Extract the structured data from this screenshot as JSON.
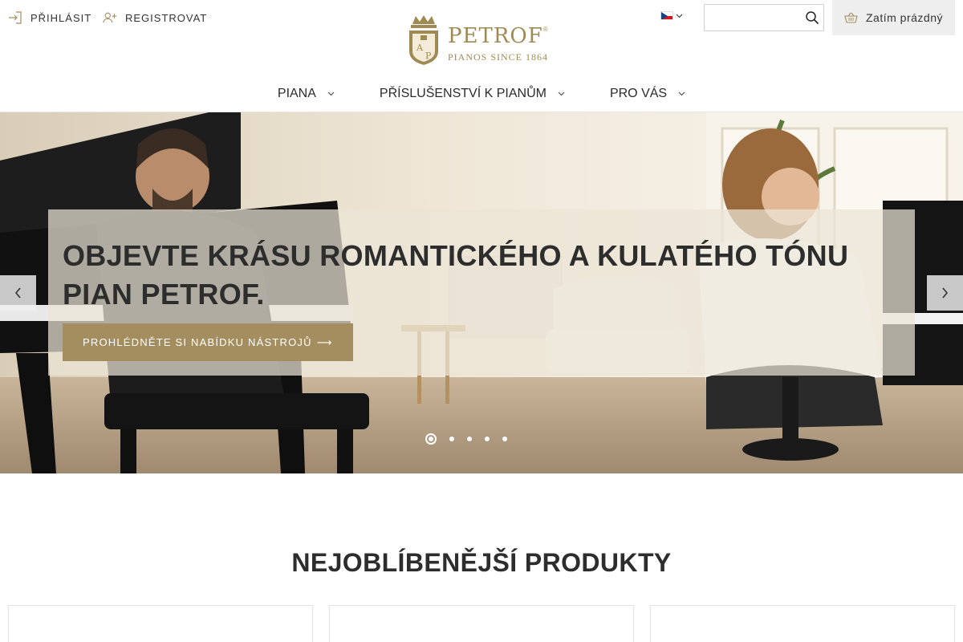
{
  "header": {
    "login_label": "PŘIHLÁSIT",
    "register_label": "REGISTROVAT",
    "logo": {
      "name": "PETROF",
      "registered": "®",
      "tagline": "PIANOS SINCE 1864",
      "crest_letters": [
        "A",
        "P"
      ]
    },
    "language": {
      "flag": "czech-flag-icon"
    },
    "search": {
      "value": "",
      "placeholder": ""
    },
    "cart_label": "Zatím prázdný"
  },
  "nav": {
    "items": [
      {
        "label": "PIANA"
      },
      {
        "label": "PŘÍSLUŠENSTVÍ K PIANŮM"
      },
      {
        "label": "PRO VÁS"
      }
    ]
  },
  "hero": {
    "title": "OBJEVTE KRÁSU ROMANTICKÉHO A KULATÉHO TÓNU PIAN PETROF.",
    "cta_label": "PROHLÉDNĚTE SI NABÍDKU NÁSTROJŮ",
    "cta_arrow": "⟶",
    "slides_count": 5,
    "active_slide": 1
  },
  "products": {
    "title": "NEJOBLÍBENĚJŠÍ PRODUKTY"
  },
  "colors": {
    "accent": "#a48d5f",
    "logo_gold": "#a08a54",
    "text": "#2d2d2d",
    "cart_bg": "#eeeeee"
  }
}
